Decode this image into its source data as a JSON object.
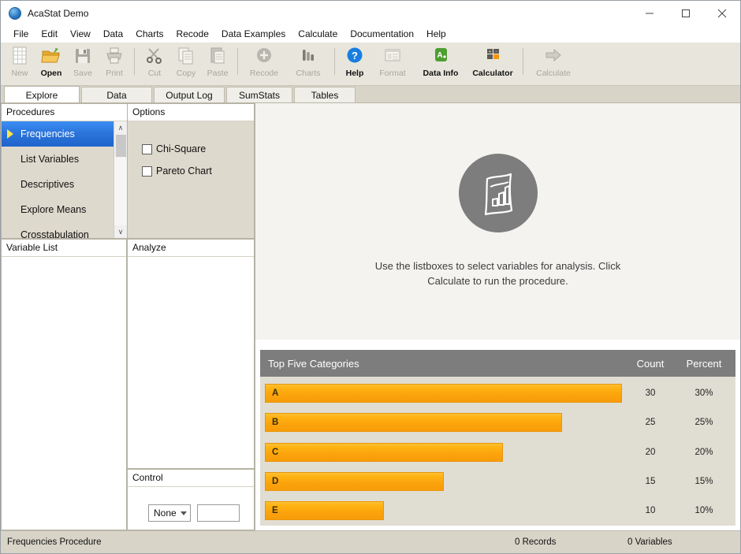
{
  "window": {
    "title": "AcaStat Demo",
    "app_icon": "app-circle-icon",
    "minimize_label": "Minimize",
    "maximize_label": "Maximize",
    "close_label": "Close"
  },
  "menubar": {
    "items": [
      {
        "label": "File"
      },
      {
        "label": "Edit"
      },
      {
        "label": "View"
      },
      {
        "label": "Data"
      },
      {
        "label": "Charts"
      },
      {
        "label": "Recode"
      },
      {
        "label": "Data Examples"
      },
      {
        "label": "Calculate"
      },
      {
        "label": "Documentation"
      },
      {
        "label": "Help"
      }
    ]
  },
  "toolbar": {
    "items": [
      {
        "label": "New",
        "icon": "new-document-icon",
        "enabled": false
      },
      {
        "label": "Open",
        "icon": "open-folder-icon",
        "enabled": true
      },
      {
        "label": "Save",
        "icon": "floppy-disk-icon",
        "enabled": false
      },
      {
        "label": "Print",
        "icon": "printer-icon",
        "enabled": false
      },
      {
        "label": "Cut",
        "icon": "scissors-icon",
        "enabled": false
      },
      {
        "label": "Copy",
        "icon": "copy-pages-icon",
        "enabled": false
      },
      {
        "label": "Paste",
        "icon": "clipboard-icon",
        "enabled": false
      },
      {
        "label": "Recode",
        "icon": "plus-circle-icon",
        "enabled": false
      },
      {
        "label": "Charts",
        "icon": "bar-chart-icon",
        "enabled": false
      },
      {
        "label": "Help",
        "icon": "question-circle-icon",
        "enabled": true
      },
      {
        "label": "Format",
        "icon": "window-format-icon",
        "enabled": false
      },
      {
        "label": "Data Info",
        "icon": "green-data-icon",
        "enabled": true
      },
      {
        "label": "Calculator",
        "icon": "calculator-icon",
        "enabled": true
      },
      {
        "label": "Calculate",
        "icon": "arrow-right-icon",
        "enabled": false
      }
    ]
  },
  "tabs": {
    "items": [
      {
        "label": "Explore",
        "active": true
      },
      {
        "label": "Data",
        "active": false
      },
      {
        "label": "Output Log",
        "active": false
      },
      {
        "label": "SumStats",
        "active": false
      },
      {
        "label": "Tables",
        "active": false
      }
    ]
  },
  "procedures": {
    "title": "Procedures",
    "items": [
      {
        "label": "Frequencies",
        "selected": true
      },
      {
        "label": "List Variables",
        "selected": false
      },
      {
        "label": "Descriptives",
        "selected": false
      },
      {
        "label": "Explore Means",
        "selected": false
      },
      {
        "label": "Crosstabulation",
        "selected": false
      }
    ],
    "scroll_up": "∧",
    "scroll_down": "∨"
  },
  "variable_list": {
    "title": "Variable List",
    "items": []
  },
  "options": {
    "title": "Options",
    "checkboxes": [
      {
        "label": "Chi-Square",
        "checked": false
      },
      {
        "label": "Pareto Chart",
        "checked": false
      }
    ]
  },
  "analyze": {
    "title": "Analyze",
    "items": []
  },
  "control": {
    "title": "Control",
    "select_value": "None",
    "input_value": ""
  },
  "main": {
    "placeholder_icon": "wavy-chart-document-icon",
    "placeholder_text": "Use the listboxes to select variables for analysis.  Click Calculate to run the procedure."
  },
  "chart_data": {
    "type": "bar",
    "title": "Top Five Categories",
    "orientation": "horizontal",
    "categories": [
      "A",
      "B",
      "C",
      "D",
      "E"
    ],
    "values": [
      30,
      25,
      20,
      15,
      10
    ],
    "columns": [
      "Top Five Categories",
      "Count",
      "Percent"
    ],
    "rows": [
      {
        "category": "A",
        "count": "30",
        "percent": "30%",
        "value": 30
      },
      {
        "category": "B",
        "count": "25",
        "percent": "25%",
        "value": 25
      },
      {
        "category": "C",
        "count": "20",
        "percent": "20%",
        "value": 20
      },
      {
        "category": "D",
        "count": "15",
        "percent": "15%",
        "value": 15
      },
      {
        "category": "E",
        "count": "10",
        "percent": "10%",
        "value": 10
      }
    ],
    "xlabel": "",
    "ylabel": "",
    "xlim": [
      0,
      30
    ],
    "grid": false,
    "legend": false,
    "bar_color": "#f9a60b",
    "header_color": "#7d7d7d"
  },
  "statusbar": {
    "procedure": "Frequencies Procedure",
    "records": "0 Records",
    "variables": "0 Variables"
  }
}
